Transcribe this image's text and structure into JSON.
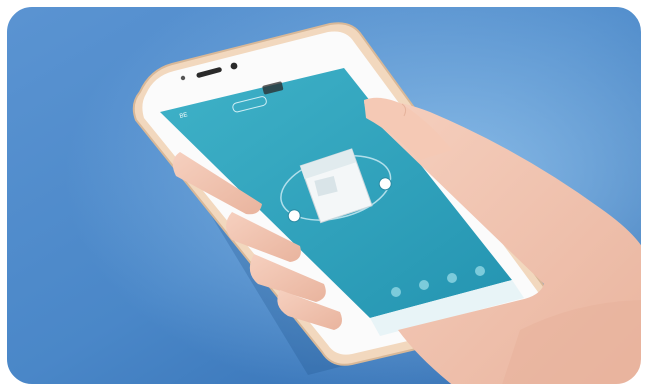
{
  "photo": {
    "subject": "hand-holding-smartphone",
    "colors": {
      "background_top": "#4f86c6",
      "background_bottom": "#2f6db0",
      "phone_frame": "#f0d6bb",
      "app_teal": "#33a7c0",
      "app_teal_dark": "#1f8ea8",
      "skin": "#f2c3ad"
    }
  },
  "app": {
    "device_name": "BE",
    "status_chip": "",
    "hint_text": "",
    "bottom_icons": [
      "power-icon",
      "mode-icon",
      "timer-icon",
      "settings-icon"
    ],
    "icon_captions": [
      "",
      "",
      "",
      ""
    ]
  }
}
